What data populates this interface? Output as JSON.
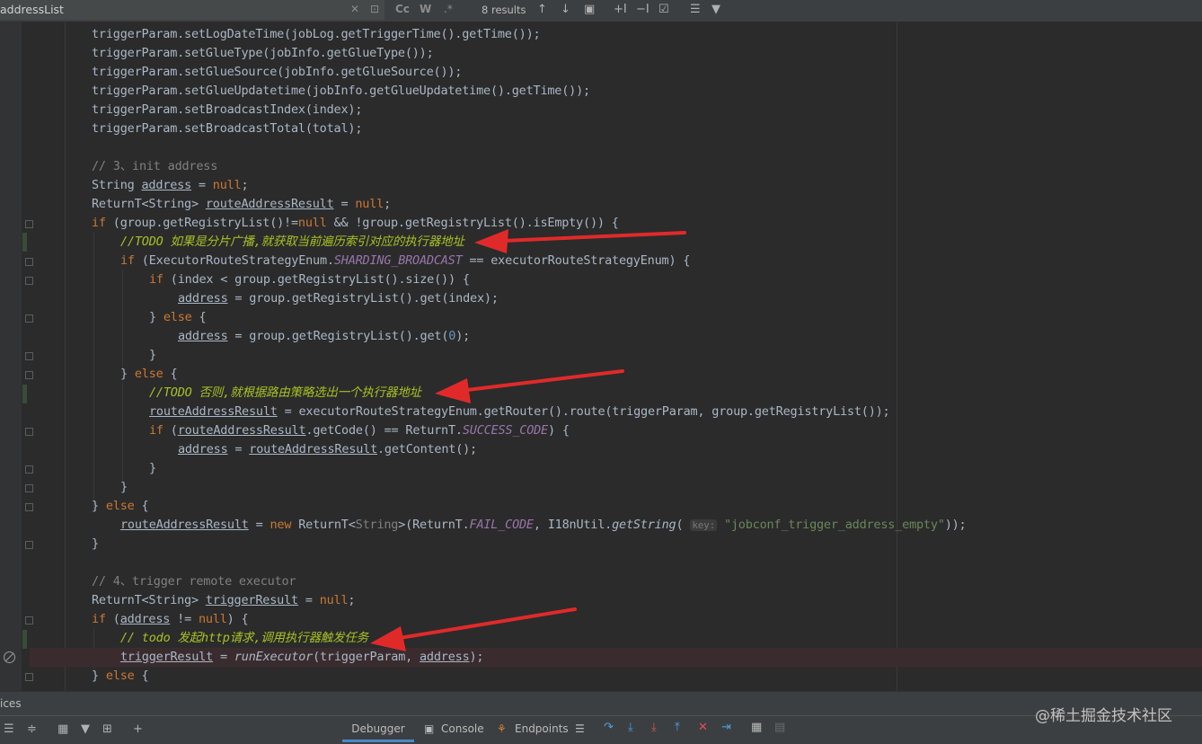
{
  "find_bar": {
    "query": "addressList",
    "match_case": "Cc",
    "whole_word": "W",
    "regex": ".*",
    "results": "8 results"
  },
  "code_lines": [
    {
      "indent": 2,
      "tokens": [
        [
          "p",
          "triggerParam.setLogDateTime(jobLog.getTriggerTime().getTime());"
        ]
      ]
    },
    {
      "indent": 2,
      "tokens": [
        [
          "p",
          "triggerParam.setGlueType(jobInfo.getGlueType());"
        ]
      ]
    },
    {
      "indent": 2,
      "tokens": [
        [
          "p",
          "triggerParam.setGlueSource(jobInfo.getGlueSource());"
        ]
      ]
    },
    {
      "indent": 2,
      "tokens": [
        [
          "p",
          "triggerParam.setGlueUpdatetime(jobInfo.getGlueUpdatetime().getTime());"
        ]
      ]
    },
    {
      "indent": 2,
      "tokens": [
        [
          "p",
          "triggerParam.setBroadcastIndex(index);"
        ]
      ]
    },
    {
      "indent": 2,
      "tokens": [
        [
          "p",
          "triggerParam.setBroadcastTotal(total);"
        ]
      ]
    },
    {
      "indent": 2,
      "tokens": []
    },
    {
      "indent": 2,
      "tokens": [
        [
          "cmt",
          "// 3、init address"
        ]
      ]
    },
    {
      "indent": 2,
      "tokens": [
        [
          "p",
          "String "
        ],
        [
          "var",
          "address"
        ],
        [
          "p",
          " = "
        ],
        [
          "kw",
          "null"
        ],
        [
          "p",
          ";"
        ]
      ]
    },
    {
      "indent": 2,
      "tokens": [
        [
          "p",
          "ReturnT<String> "
        ],
        [
          "var",
          "routeAddressResult"
        ],
        [
          "p",
          " = "
        ],
        [
          "kw",
          "null"
        ],
        [
          "p",
          ";"
        ]
      ]
    },
    {
      "indent": 2,
      "tokens": [
        [
          "kw",
          "if"
        ],
        [
          "p",
          " (group.getRegistryList()!="
        ],
        [
          "kw",
          "null"
        ],
        [
          "p",
          " && !group.getRegistryList().isEmpty()) {"
        ]
      ]
    },
    {
      "indent": 3,
      "tokens": [
        [
          "todo",
          "//TODO 如果是分片广播,就获取当前遍历索引对应的执行器地址"
        ]
      ]
    },
    {
      "indent": 3,
      "tokens": [
        [
          "kw",
          "if"
        ],
        [
          "p",
          " (ExecutorRouteStrategyEnum."
        ],
        [
          "fd",
          "SHARDING_BROADCAST"
        ],
        [
          "p",
          " == executorRouteStrategyEnum) {"
        ]
      ]
    },
    {
      "indent": 4,
      "tokens": [
        [
          "kw",
          "if"
        ],
        [
          "p",
          " (index < group.getRegistryList().size()) {"
        ]
      ]
    },
    {
      "indent": 5,
      "tokens": [
        [
          "var",
          "address"
        ],
        [
          "p",
          " = group.getRegistryList().get(index);"
        ]
      ]
    },
    {
      "indent": 4,
      "tokens": [
        [
          "p",
          "} "
        ],
        [
          "kw",
          "else"
        ],
        [
          "p",
          " {"
        ]
      ]
    },
    {
      "indent": 5,
      "tokens": [
        [
          "var",
          "address"
        ],
        [
          "p",
          " = group.getRegistryList().get("
        ],
        [
          "num",
          "0"
        ],
        [
          "p",
          ");"
        ]
      ]
    },
    {
      "indent": 4,
      "tokens": [
        [
          "p",
          "}"
        ]
      ]
    },
    {
      "indent": 3,
      "tokens": [
        [
          "p",
          "} "
        ],
        [
          "kw",
          "else"
        ],
        [
          "p",
          " {"
        ]
      ]
    },
    {
      "indent": 4,
      "tokens": [
        [
          "todo",
          "//TODO 否则,就根据路由策略选出一个执行器地址"
        ]
      ]
    },
    {
      "indent": 4,
      "tokens": [
        [
          "var",
          "routeAddressResult"
        ],
        [
          "p",
          " = executorRouteStrategyEnum.getRouter().route(triggerParam, group.getRegistryList());"
        ]
      ]
    },
    {
      "indent": 4,
      "tokens": [
        [
          "kw",
          "if"
        ],
        [
          "p",
          " ("
        ],
        [
          "var",
          "routeAddressResult"
        ],
        [
          "p",
          ".getCode() == ReturnT."
        ],
        [
          "fd",
          "SUCCESS_CODE"
        ],
        [
          "p",
          ") {"
        ]
      ]
    },
    {
      "indent": 5,
      "tokens": [
        [
          "var",
          "address"
        ],
        [
          "p",
          " = "
        ],
        [
          "var",
          "routeAddressResult"
        ],
        [
          "p",
          ".getContent();"
        ]
      ]
    },
    {
      "indent": 4,
      "tokens": [
        [
          "p",
          "}"
        ]
      ]
    },
    {
      "indent": 3,
      "tokens": [
        [
          "p",
          "}"
        ]
      ]
    },
    {
      "indent": 2,
      "tokens": [
        [
          "p",
          "} "
        ],
        [
          "kw",
          "else"
        ],
        [
          "p",
          " {"
        ]
      ]
    },
    {
      "indent": 3,
      "tokens": [
        [
          "var",
          "routeAddressResult"
        ],
        [
          "p",
          " = "
        ],
        [
          "kw",
          "new"
        ],
        [
          "p",
          " ReturnT<"
        ],
        [
          "gen",
          "String"
        ],
        [
          "p",
          ">(ReturnT."
        ],
        [
          "fd",
          "FAIL_CODE"
        ],
        [
          "p",
          ", I18nUtil."
        ],
        [
          "sfn",
          "getString"
        ],
        [
          "p",
          "( "
        ],
        [
          "hint",
          "key:"
        ],
        [
          "str",
          " \"jobconf_trigger_address_empty\""
        ],
        [
          "p",
          "));"
        ]
      ]
    },
    {
      "indent": 2,
      "tokens": [
        [
          "p",
          "}"
        ]
      ]
    },
    {
      "indent": 2,
      "tokens": []
    },
    {
      "indent": 2,
      "tokens": [
        [
          "cmt",
          "// 4、trigger remote executor"
        ]
      ]
    },
    {
      "indent": 2,
      "tokens": [
        [
          "p",
          "ReturnT<String> "
        ],
        [
          "var",
          "triggerResult"
        ],
        [
          "p",
          " = "
        ],
        [
          "kw",
          "null"
        ],
        [
          "p",
          ";"
        ]
      ]
    },
    {
      "indent": 2,
      "tokens": [
        [
          "kw",
          "if"
        ],
        [
          "p",
          " ("
        ],
        [
          "var",
          "address"
        ],
        [
          "p",
          " != "
        ],
        [
          "kw",
          "null"
        ],
        [
          "p",
          ") {"
        ]
      ]
    },
    {
      "indent": 3,
      "tokens": [
        [
          "todo",
          "// todo 发起http请求,调用执行器触发任务"
        ]
      ]
    },
    {
      "indent": 3,
      "hl": true,
      "tokens": [
        [
          "var",
          "triggerResult"
        ],
        [
          "p",
          " = "
        ],
        [
          "sfn",
          "runExecutor"
        ],
        [
          "p",
          "(triggerParam, "
        ],
        [
          "var",
          "address"
        ],
        [
          "p",
          ");"
        ]
      ]
    },
    {
      "indent": 2,
      "tokens": [
        [
          "p",
          "} "
        ],
        [
          "kw",
          "else"
        ],
        [
          "p",
          " {"
        ]
      ]
    }
  ],
  "tool_window": {
    "title": "ices",
    "tabs": [
      "Debugger",
      "Console",
      "Endpoints"
    ],
    "active_tab": "Debugger"
  },
  "watermark": "@稀土掘金技术社区",
  "colors": {
    "background": "#2b2b2b",
    "keyword": "#cc7832",
    "string": "#6a8759",
    "number": "#6897bb",
    "field": "#9876aa",
    "todo": "#a8c023",
    "arrow": "#e02a2a"
  }
}
